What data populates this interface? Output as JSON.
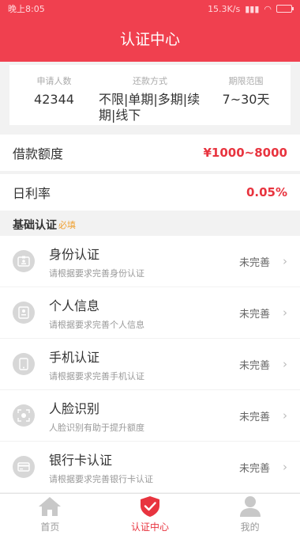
{
  "statusbar": {
    "left": "晚上8:05",
    "speed": "15.3K/s",
    "signal": "▮▮▮",
    "wifi": "◠",
    "battery": ""
  },
  "header": {
    "title": "认证中心"
  },
  "stats": [
    {
      "label": "申请人数",
      "value": "42344"
    },
    {
      "label": "还款方式",
      "value": "不限|单期|多期|续期|线下"
    },
    {
      "label": "期限范围",
      "value": "7~30天"
    }
  ],
  "loan_amount": {
    "label": "借款额度",
    "value": "¥1000~8000"
  },
  "daily_rate": {
    "label": "日利率",
    "value": "0.05%"
  },
  "section": {
    "title": "基础认证",
    "required": "必填"
  },
  "verify_items": [
    {
      "title": "身份认证",
      "desc": "请根据要求完善身份认证",
      "status": "未完善",
      "icon": "id-card-icon"
    },
    {
      "title": "个人信息",
      "desc": "请根据要求完善个人信息",
      "status": "未完善",
      "icon": "profile-icon"
    },
    {
      "title": "手机认证",
      "desc": "请根据要求完善手机认证",
      "status": "未完善",
      "icon": "phone-icon"
    },
    {
      "title": "人脸识别",
      "desc": "人脸识别有助于提升额度",
      "status": "未完善",
      "icon": "face-icon"
    },
    {
      "title": "银行卡认证",
      "desc": "请根据要求完善银行卡认证",
      "status": "未完善",
      "icon": "bank-card-icon"
    }
  ],
  "tabs": [
    {
      "label": "首页",
      "icon": "home-icon"
    },
    {
      "label": "认证中心",
      "icon": "shield-check-icon",
      "active": true
    },
    {
      "label": "我的",
      "icon": "user-icon"
    }
  ],
  "colors": {
    "brand": "#f0404f",
    "accent": "#e8343f",
    "required": "#f0a030",
    "inactive": "#999999"
  }
}
